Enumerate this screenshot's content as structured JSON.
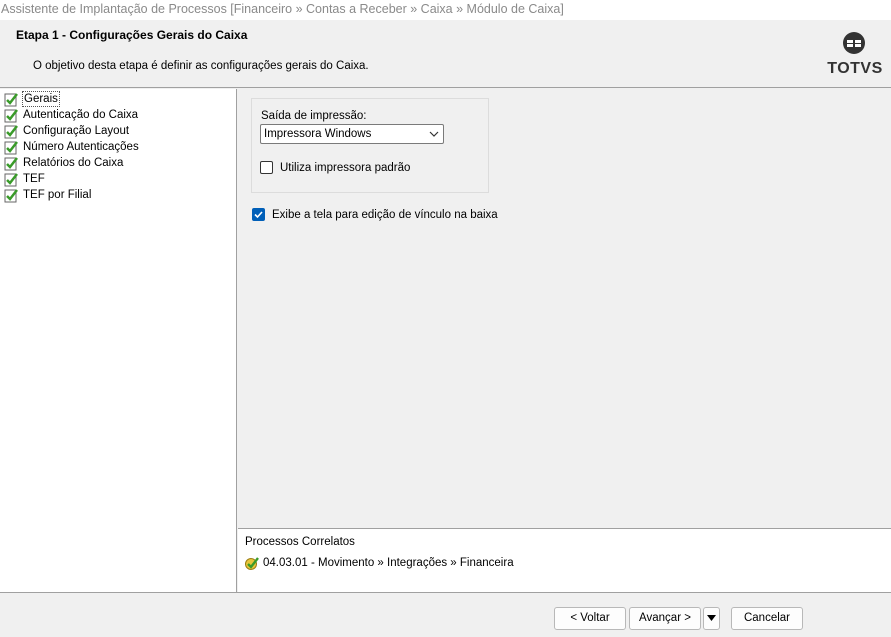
{
  "window": {
    "title": "Assistente de Implantação de Processos [Financeiro » Contas a Receber » Caixa » Módulo de Caixa]"
  },
  "header": {
    "step_title": "Etapa 1 - Configurações Gerais do Caixa",
    "step_description": "O objetivo desta etapa é definir as configurações gerais do Caixa.",
    "logo_text": "TOTVS"
  },
  "steps": {
    "items": [
      {
        "label": "Gerais",
        "selected": true,
        "icon": "green-check-icon"
      },
      {
        "label": "Autenticação do Caixa",
        "icon": "green-check-icon"
      },
      {
        "label": "Configuração Layout",
        "icon": "green-check-icon"
      },
      {
        "label": "Número Autenticações",
        "icon": "green-check-icon"
      },
      {
        "label": "Relatórios do Caixa",
        "icon": "green-check-icon"
      },
      {
        "label": "TEF",
        "icon": "green-check-icon"
      },
      {
        "label": "TEF por Filial",
        "icon": "green-check-icon"
      }
    ]
  },
  "form": {
    "print_output_label": "Saída de impressão:",
    "print_output_value": "Impressora Windows",
    "default_printer_label": "Utiliza impressora padrão",
    "default_printer_checked": false,
    "show_link_edit_label": "Exibe a tela para edição de vínculo na baixa",
    "show_link_edit_checked": true
  },
  "correlated": {
    "title": "Processos Correlatos",
    "link_text": "04.03.01 - Movimento » Integrações » Financeira"
  },
  "buttons": {
    "back": "< Voltar",
    "next": "Avançar >",
    "cancel": "Cancelar"
  },
  "colors": {
    "accent": "#005fb8",
    "check_green": "#3a9b2a"
  }
}
